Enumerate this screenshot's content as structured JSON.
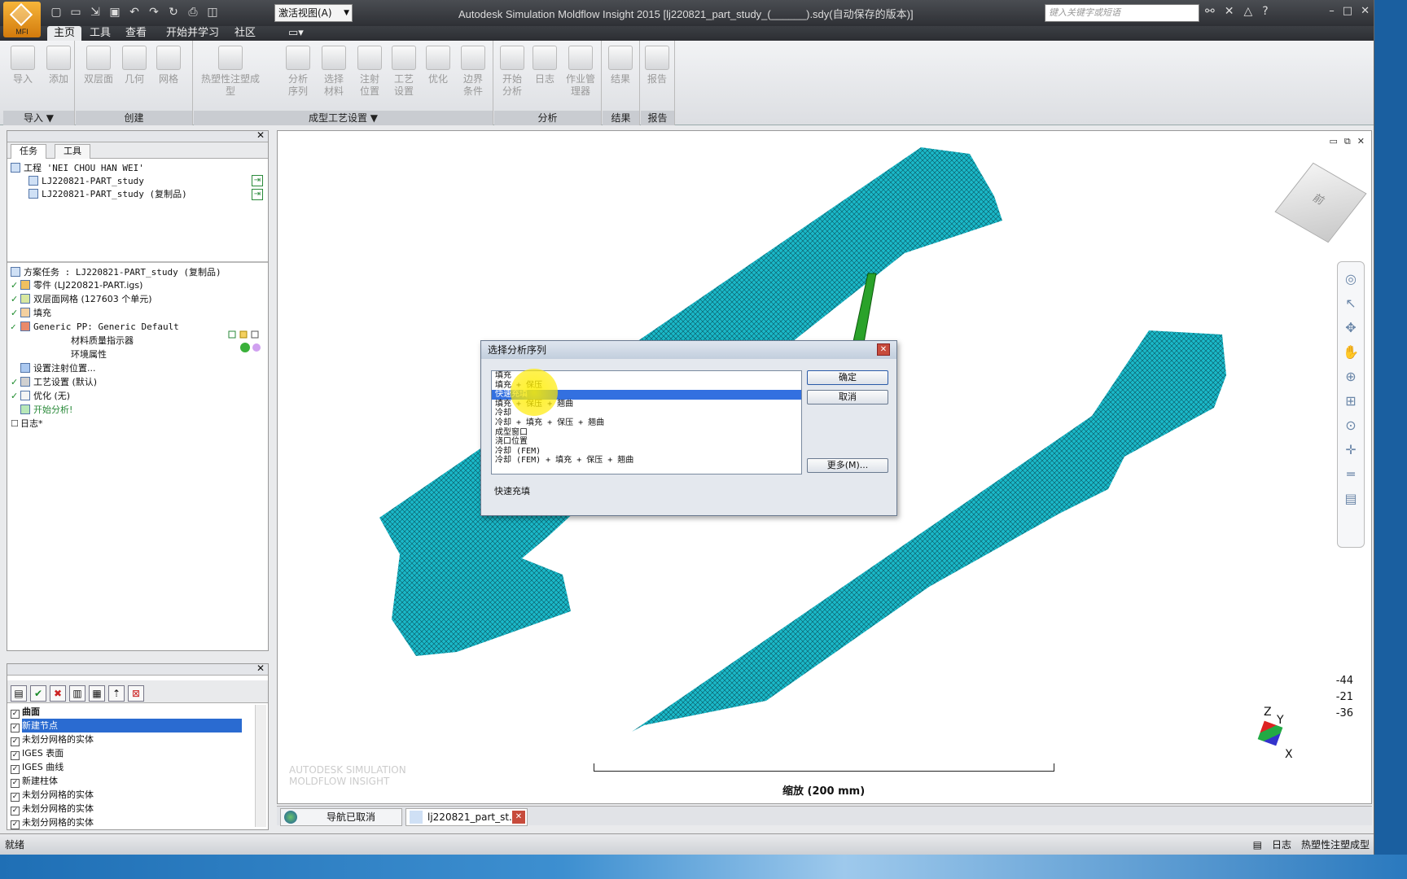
{
  "app": {
    "menu_label": "MFI",
    "title": "Autodesk Simulation Moldflow Insight 2015     [lj220821_part_study_(______).sdy(自动保存的版本)]",
    "view_select": "激活视图(A)",
    "search_placeholder": "键入关键字或短语"
  },
  "menu_tabs": [
    "主页",
    "工具",
    "查看",
    "开始并学习",
    "社区"
  ],
  "ribbon": {
    "groups": [
      {
        "title": "导入 ▼",
        "buttons": [
          "导入",
          "添加"
        ]
      },
      {
        "title": "创建",
        "buttons": [
          "双层面",
          "几何",
          "网格"
        ]
      },
      {
        "title": "成型工艺设置 ▼",
        "buttons": [
          "热塑性注塑成型",
          "分析序列",
          "选择材料",
          "注射位置",
          "工艺设置",
          "优化",
          "边界条件"
        ]
      },
      {
        "title": "分析",
        "buttons": [
          "开始分析",
          "日志",
          "作业管理器"
        ]
      },
      {
        "title": "结果",
        "buttons": [
          "结果"
        ]
      },
      {
        "title": "报告",
        "buttons": [
          "报告"
        ]
      }
    ]
  },
  "left_panel": {
    "tabs": [
      "任务",
      "工具"
    ],
    "project": "工程 'NEI CHOU HAN WEI'",
    "studies": [
      "LJ220821-PART_study",
      "LJ220821-PART_study (复制品)"
    ],
    "tasks": [
      {
        "check": "",
        "text": "方案任务 : LJ220821-PART_study (复制品)"
      },
      {
        "check": "✓",
        "text": "零件 (LJ220821-PART.igs)"
      },
      {
        "check": "✓",
        "text": "双层面网格 (127603 个单元)"
      },
      {
        "check": "✓",
        "text": "填充"
      },
      {
        "check": "✓",
        "text": "Generic PP: Generic Default"
      },
      {
        "check": "",
        "text": "材料质量指示器"
      },
      {
        "check": "",
        "text": "环境属性"
      },
      {
        "check": "",
        "text": "设置注射位置..."
      },
      {
        "check": "✓",
        "text": "工艺设置 (默认)"
      },
      {
        "check": "✓",
        "text": "优化 (无)"
      },
      {
        "check": "",
        "text": "开始分析!"
      },
      {
        "check": "☐",
        "text": "日志*"
      }
    ]
  },
  "layers": {
    "items": [
      {
        "text": "曲面",
        "selected": false
      },
      {
        "text": "新建节点",
        "selected": true
      },
      {
        "text": "未划分网格的实体",
        "selected": false
      },
      {
        "text": "IGES 表面",
        "selected": false
      },
      {
        "text": "IGES 曲线",
        "selected": false
      },
      {
        "text": "新建柱体",
        "selected": false
      },
      {
        "text": "未划分网格的实体",
        "selected": false
      },
      {
        "text": "未划分网格的实体",
        "selected": false
      },
      {
        "text": "未划分网格的实体",
        "selected": false
      }
    ]
  },
  "dialog": {
    "title": "选择分析序列",
    "items": [
      "填充",
      "填充 + 保压",
      "快速充填",
      "填充 + 保压 + 翘曲",
      "冷却",
      "冷却 + 填充 + 保压 + 翘曲",
      "成型窗口",
      "浇口位置",
      "冷却 (FEM)",
      "冷却 (FEM) + 填充 + 保压 + 翘曲"
    ],
    "selected_index": 2,
    "ok": "确定",
    "cancel": "取消",
    "more": "更多(M)...",
    "description": "快速充填"
  },
  "viewport": {
    "scale_label": "缩放 (200 mm)",
    "coords": [
      "-44",
      "-21",
      "-36"
    ],
    "axes": {
      "z": "Z",
      "y": "Y",
      "x": "X"
    },
    "cube_face": "前",
    "watermark": "AUTODESK SIMULATION MOLDFLOW INSIGHT"
  },
  "doc_tabs": [
    "导航已取消",
    "lj220821_part_st..."
  ],
  "status": {
    "left": "就绪",
    "log": "日志",
    "mode": "热塑性注塑成型"
  },
  "colors": {
    "mesh": "#1ab8c8",
    "runner": "#2aa22a",
    "selection": "#3370e0"
  }
}
